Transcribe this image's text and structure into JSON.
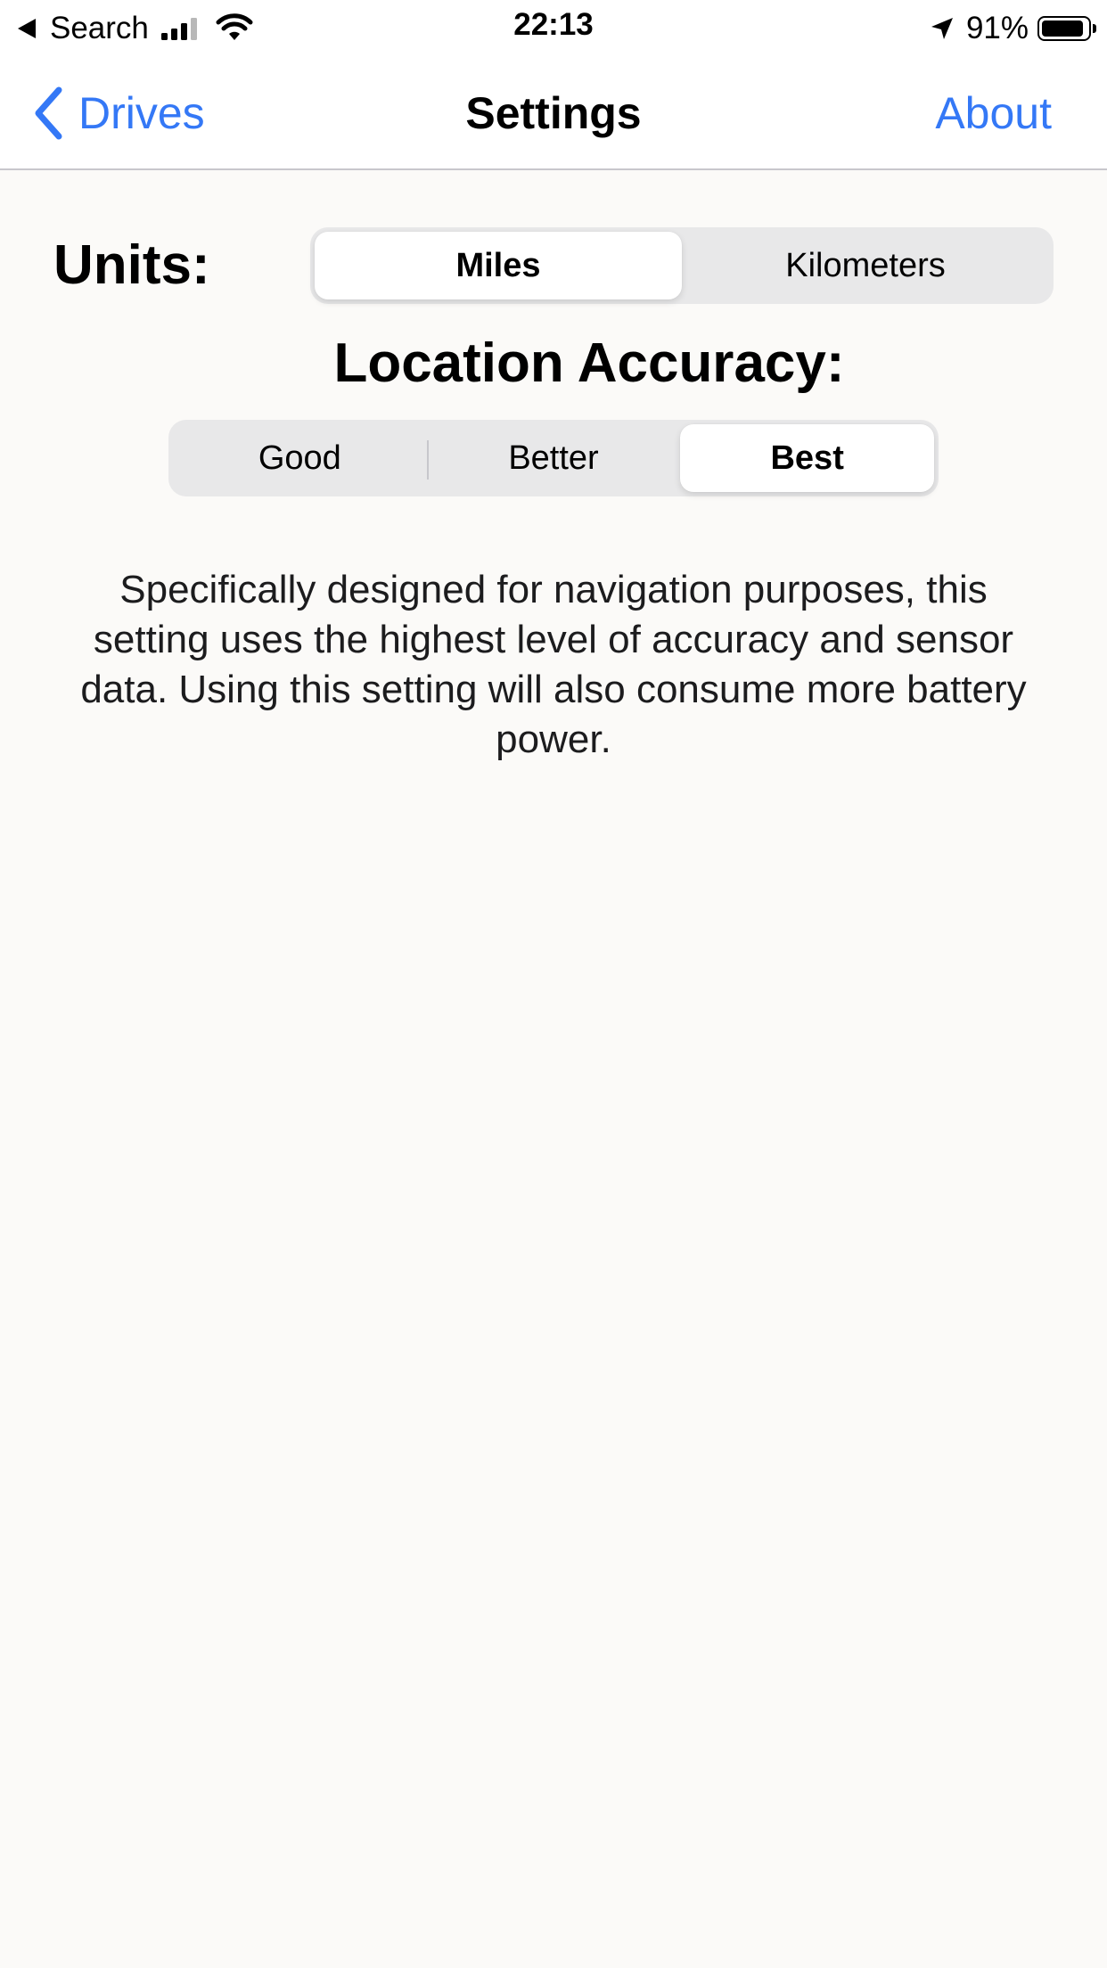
{
  "status_bar": {
    "back_app": "Search",
    "time": "22:13",
    "battery_percent": "91%",
    "battery_level": 0.91,
    "signal_bars_active": 3,
    "signal_bars_total": 4,
    "icons": [
      "back-triangle-icon",
      "signal-icon",
      "wifi-icon",
      "location-arrow-icon",
      "battery-icon"
    ]
  },
  "nav": {
    "back_label": "Drives",
    "title": "Settings",
    "right_label": "About",
    "accent_color": "#3478f6"
  },
  "units": {
    "label": "Units:",
    "options": [
      "Miles",
      "Kilometers"
    ],
    "selected": "Miles"
  },
  "accuracy": {
    "title": "Location Accuracy:",
    "options": [
      "Good",
      "Better",
      "Best"
    ],
    "selected": "Best"
  },
  "description": "Specifically designed for navigation purposes, this setting uses the highest level of accuracy and sensor data. Using this setting will also consume more battery power."
}
